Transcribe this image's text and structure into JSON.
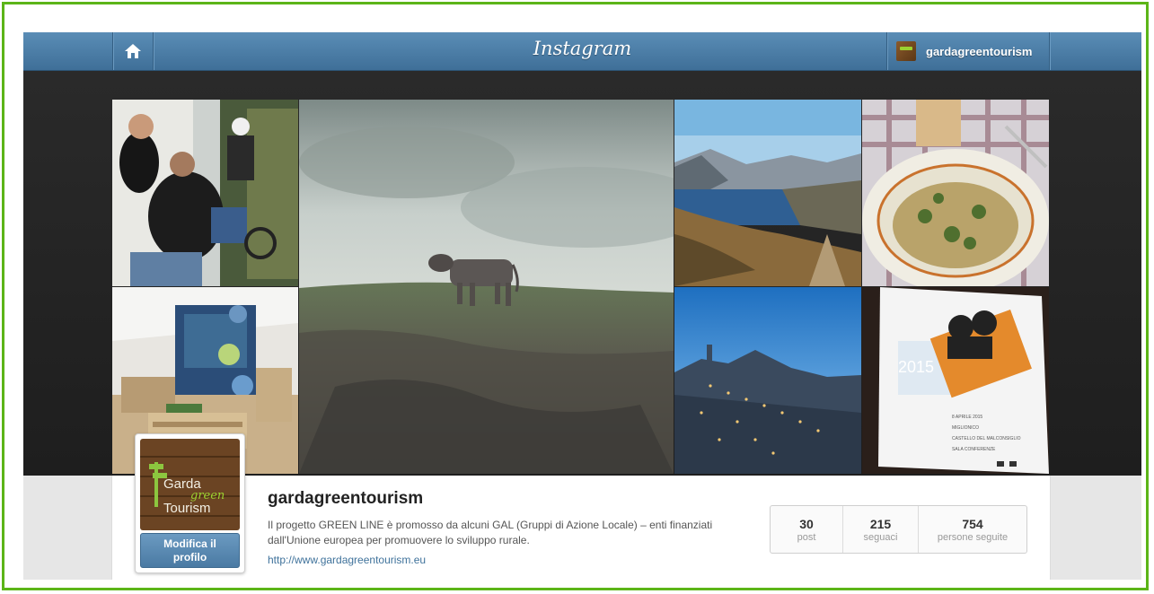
{
  "app": {
    "logo": "Instagram"
  },
  "topbar": {
    "home_icon": "home-icon",
    "username": "gardagreentourism"
  },
  "profile": {
    "username": "gardagreentourism",
    "bio": "Il progetto GREEN LINE è promosso da alcuni GAL (Gruppi di Azione Locale) – enti finanziati dall'Unione europea per promuovere lo sviluppo rurale.",
    "website": "http://www.gardagreentourism.eu",
    "edit_button": "Modifica il profilo",
    "avatar_logo": {
      "line1": "Garda",
      "line2": "green",
      "line3": "Tourism"
    }
  },
  "stats": [
    {
      "value": "30",
      "label": "post"
    },
    {
      "value": "215",
      "label": "seguaci"
    },
    {
      "value": "754",
      "label": "persone seguite"
    }
  ],
  "photos": [
    {
      "name": "photo-bike-trainer"
    },
    {
      "name": "photo-cow-meadow"
    },
    {
      "name": "photo-lake-view"
    },
    {
      "name": "photo-pasta-dish"
    },
    {
      "name": "photo-expo-stand"
    },
    {
      "name": "photo-village-night"
    },
    {
      "name": "photo-event-flyer"
    }
  ],
  "flyer": {
    "year": "2015",
    "lines": [
      "8 APRILE 2015",
      "MIGLIONICO",
      "CASTELLO DEL MALCONSIGLIO",
      "SALA CONFERENZE"
    ]
  },
  "colors": {
    "accent": "#3f729b",
    "frame": "#5cb518",
    "topbar": "#4a7ba5"
  }
}
